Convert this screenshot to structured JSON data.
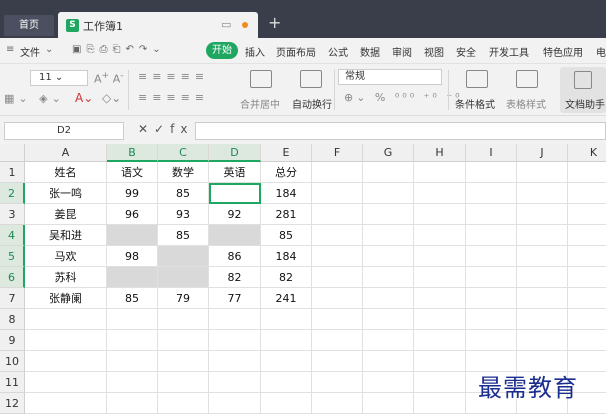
{
  "tabs": {
    "home": "首页",
    "workbook": "工作簿1",
    "logo": "S",
    "new_tab": "+"
  },
  "menu": {
    "file": "文件",
    "items": [
      "开始",
      "插入",
      "页面布局",
      "公式",
      "数据",
      "审阅",
      "视图",
      "安全",
      "开发工具",
      "特色应用",
      "电"
    ]
  },
  "toolbar": {
    "font_size": "11",
    "number_format": "常规",
    "merge": "合并居中",
    "wrap": "自动换行",
    "cond_format": "条件格式",
    "table_style": "表格样式",
    "doc_assistant": "文档助手"
  },
  "formula_bar": {
    "cell_ref": "D2",
    "fx": "fx",
    "content": ""
  },
  "colors": {
    "accent": "#1fa661",
    "titlebar": "#3a3d4a",
    "empty_cell": "#d9d9d9"
  },
  "sheet": {
    "columns": [
      "A",
      "B",
      "C",
      "D",
      "E",
      "F",
      "G",
      "H",
      "I",
      "J",
      "K"
    ],
    "row_numbers": [
      "1",
      "2",
      "3",
      "4",
      "5",
      "6",
      "7",
      "8",
      "9",
      "10",
      "11",
      "12"
    ],
    "rows": [
      [
        "姓名",
        "语文",
        "数学",
        "英语",
        "总分"
      ],
      [
        "张一鸣",
        "99",
        "85",
        "",
        "184"
      ],
      [
        "姜昆",
        "96",
        "93",
        "92",
        "281"
      ],
      [
        "吴和进",
        "",
        "85",
        "",
        "85"
      ],
      [
        "马欢",
        "98",
        "",
        "86",
        "184"
      ],
      [
        "苏科",
        "",
        "",
        "82",
        "82"
      ],
      [
        "张静阑",
        "85",
        "79",
        "77",
        "241"
      ]
    ]
  },
  "watermark": "最需教育"
}
